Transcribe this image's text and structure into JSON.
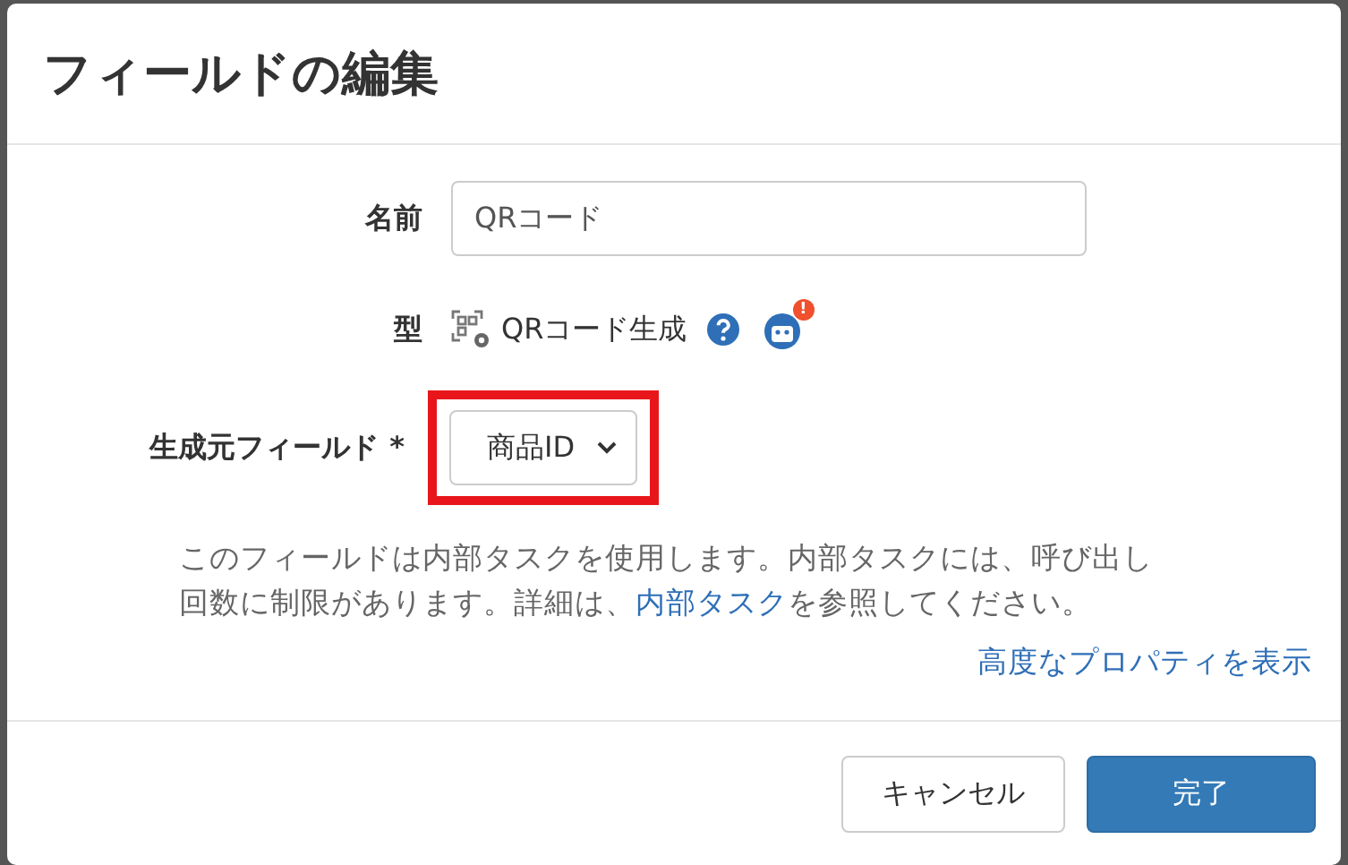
{
  "dialog": {
    "title": "フィールドの編集"
  },
  "fields": [
    {
      "kind": "input",
      "label": "名前",
      "value": "QRコード"
    },
    {
      "kind": "type",
      "label": "型",
      "value": "QRコード生成",
      "badge": "!"
    },
    {
      "kind": "select",
      "label": "生成元フィールド",
      "required_mark": "*",
      "value": "商品ID",
      "highlighted": true
    }
  ],
  "help": {
    "before": "このフィールドは内部タスクを使用します。内部タスクには、呼び出し回数に制限があります。詳細は、",
    "link": "内部タスク",
    "after": "を参照してください。"
  },
  "advanced_link": "高度なプロパティを表示",
  "buttons": [
    {
      "label": "キャンセル",
      "primary": false
    },
    {
      "label": "完了",
      "primary": true
    }
  ]
}
